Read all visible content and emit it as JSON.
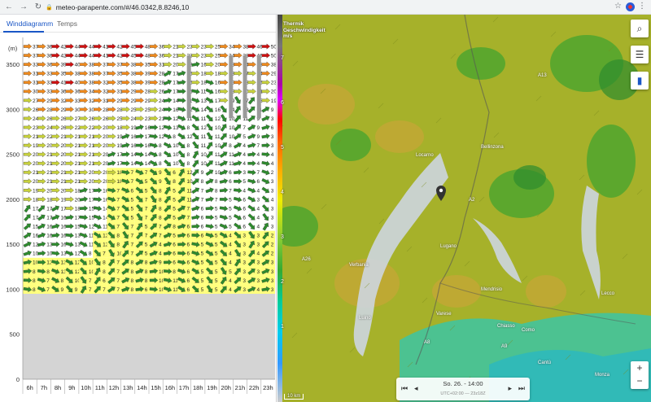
{
  "browser": {
    "url": "meteo-parapente.com/#/46.0342,8.8246,10"
  },
  "tabs": [
    {
      "label": "Winddiagramm",
      "active": true
    },
    {
      "label": "Temps",
      "active": false
    }
  ],
  "chart_data": {
    "type": "table",
    "y_unit_label": "(m)",
    "y_ticks": [
      0,
      500,
      1000,
      1500,
      2000,
      2500,
      3000,
      3500
    ],
    "hours": [
      "6h",
      "7h",
      "8h",
      "9h",
      "10h",
      "11h",
      "12h",
      "13h",
      "14h",
      "15h",
      "16h",
      "17h",
      "18h",
      "19h",
      "20h",
      "21h",
      "22h",
      "23h"
    ],
    "ground_altitude_m": 950,
    "rows_altitude_m": [
      3700,
      3600,
      3500,
      3400,
      3300,
      3200,
      3100,
      3000,
      2900,
      2800,
      2700,
      2600,
      2500,
      2400,
      2300,
      2200,
      2100,
      2000,
      1900,
      1800,
      1700,
      1600,
      1500,
      1400,
      1300,
      1200,
      1100,
      1000
    ],
    "speed_grid": [
      [
        37,
        36,
        42,
        44,
        44,
        41,
        42,
        45,
        48,
        36,
        21,
        23,
        23,
        25,
        34,
        38,
        46,
        50
      ],
      [
        37,
        36,
        42,
        44,
        44,
        41,
        42,
        45,
        48,
        36,
        21,
        23,
        23,
        25,
        34,
        38,
        46,
        50
      ],
      [
        33,
        36,
        39,
        40,
        38,
        37,
        37,
        38,
        35,
        31,
        20,
        18,
        16,
        20,
        28,
        34,
        38,
        38
      ],
      [
        31,
        33,
        35,
        38,
        38,
        37,
        35,
        38,
        39,
        28,
        17,
        16,
        18,
        18,
        23,
        27,
        24,
        29
      ],
      [
        31,
        33,
        41,
        40,
        38,
        32,
        35,
        38,
        39,
        28,
        17,
        16,
        18,
        16,
        29,
        28,
        25,
        23
      ],
      [
        30,
        33,
        36,
        36,
        34,
        32,
        31,
        29,
        28,
        26,
        17,
        16,
        11,
        16,
        18,
        20,
        21,
        20
      ],
      [
        27,
        29,
        32,
        33,
        32,
        31,
        29,
        29,
        29,
        24,
        14,
        11,
        13,
        17,
        19,
        17,
        15,
        19
      ],
      [
        26,
        28,
        29,
        30,
        30,
        28,
        28,
        25,
        25,
        24,
        16,
        12,
        14,
        16,
        14,
        13,
        11,
        9
      ],
      [
        24,
        26,
        26,
        27,
        26,
        26,
        25,
        24,
        23,
        21,
        12,
        11,
        11,
        12,
        10,
        11,
        9,
        3
      ],
      [
        23,
        24,
        26,
        22,
        22,
        20,
        18,
        19,
        16,
        12,
        13,
        8,
        12,
        10,
        10,
        7,
        9,
        6
      ],
      [
        21,
        22,
        21,
        21,
        21,
        20,
        19,
        16,
        17,
        12,
        8,
        12,
        11,
        11,
        10,
        5,
        9,
        3
      ],
      [
        19,
        20,
        20,
        21,
        21,
        20,
        19,
        16,
        16,
        8,
        10,
        8,
        11,
        10,
        8,
        4,
        7,
        3
      ],
      [
        20,
        21,
        20,
        21,
        21,
        20,
        17,
        14,
        14,
        8,
        10,
        8,
        10,
        11,
        11,
        4,
        4,
        4
      ],
      [
        20,
        21,
        20,
        21,
        21,
        20,
        17,
        14,
        14,
        8,
        10,
        8,
        10,
        11,
        11,
        4,
        4,
        4
      ],
      [
        21,
        21,
        21,
        21,
        20,
        20,
        18,
        7,
        7,
        9,
        6,
        12,
        9,
        10,
        6,
        3,
        7,
        2
      ],
      [
        20,
        21,
        21,
        21,
        20,
        20,
        18,
        7,
        5,
        9,
        8,
        10,
        8,
        8,
        6,
        5,
        6,
        3
      ],
      [
        19,
        20,
        20,
        18,
        17,
        16,
        7,
        6,
        5,
        8,
        5,
        11,
        7,
        8,
        7,
        4,
        4,
        3
      ],
      [
        18,
        18,
        19,
        20,
        17,
        16,
        7,
        5,
        7,
        8,
        5,
        11,
        7,
        7,
        5,
        6,
        3,
        4
      ],
      [
        17,
        17,
        17,
        18,
        15,
        14,
        7,
        5,
        7,
        8,
        5,
        7,
        6,
        5,
        5,
        6,
        4,
        3
      ],
      [
        17,
        17,
        16,
        17,
        15,
        14,
        7,
        5,
        7,
        8,
        5,
        7,
        6,
        5,
        5,
        6,
        4,
        3
      ],
      [
        15,
        16,
        16,
        15,
        12,
        11,
        7,
        7,
        5,
        7,
        8,
        6,
        6,
        5,
        5,
        6,
        4,
        3
      ],
      [
        16,
        16,
        16,
        13,
        11,
        12,
        8,
        7,
        7,
        7,
        5,
        6,
        6,
        5,
        4,
        3,
        3,
        2
      ],
      [
        12,
        13,
        16,
        13,
        11,
        12,
        8,
        7,
        5,
        4,
        6,
        6,
        5,
        5,
        4,
        3,
        3,
        2
      ],
      [
        10,
        10,
        13,
        12,
        8,
        7,
        10,
        7,
        5,
        4,
        6,
        6,
        5,
        5,
        4,
        3,
        4,
        2
      ],
      [
        10,
        12,
        13,
        12,
        10,
        8,
        7,
        8,
        8,
        9,
        6,
        6,
        5,
        5,
        4,
        3,
        3,
        3
      ],
      [
        8,
        8,
        13,
        12,
        10,
        8,
        7,
        8,
        8,
        10,
        8,
        6,
        5,
        5,
        5,
        3,
        3,
        3
      ],
      [
        8,
        7,
        8,
        10,
        7,
        6,
        7,
        8,
        8,
        10,
        11,
        6,
        5,
        5,
        4,
        3,
        3,
        3
      ],
      [
        8,
        7,
        9,
        9,
        7,
        7,
        7,
        8,
        6,
        10,
        11,
        6,
        5,
        5,
        4,
        3,
        4,
        3
      ]
    ],
    "thermal_zone": {
      "description_from_image": "yellow highlighted cells"
    },
    "colors": {
      "strong_red": "#d01010",
      "orange": "#f08a1c",
      "yellow_green": "#c8d23c",
      "green": "#2e8b2e",
      "thermal_yellow": "#ffff66",
      "ground_grey": "#d4d4d4"
    }
  },
  "map": {
    "legend_lines": [
      "Thermik",
      "Geschwindigkeit",
      "m/s"
    ],
    "strip_ticks": [
      "7",
      "6",
      "5",
      "4",
      "3",
      "2",
      "1"
    ],
    "scale_bar": "10 km",
    "places": [
      "Locarno",
      "Bellinzona",
      "Lugano",
      "Varese",
      "Como",
      "Lecco",
      "Verbania",
      "Mendrisio",
      "Chiasso",
      "Luino",
      "Cantù",
      "Monza",
      "A2",
      "A13",
      "A26",
      "A9",
      "A8"
    ],
    "time": {
      "label": "So. 26. - 14:00",
      "sub": "UTC+02:00 — 23z18Z"
    },
    "buttons": {
      "search": "search-icon",
      "settings": "sliders-icon",
      "chart": "bar-chart-icon",
      "zoom_in": "+",
      "zoom_out": "−"
    }
  }
}
